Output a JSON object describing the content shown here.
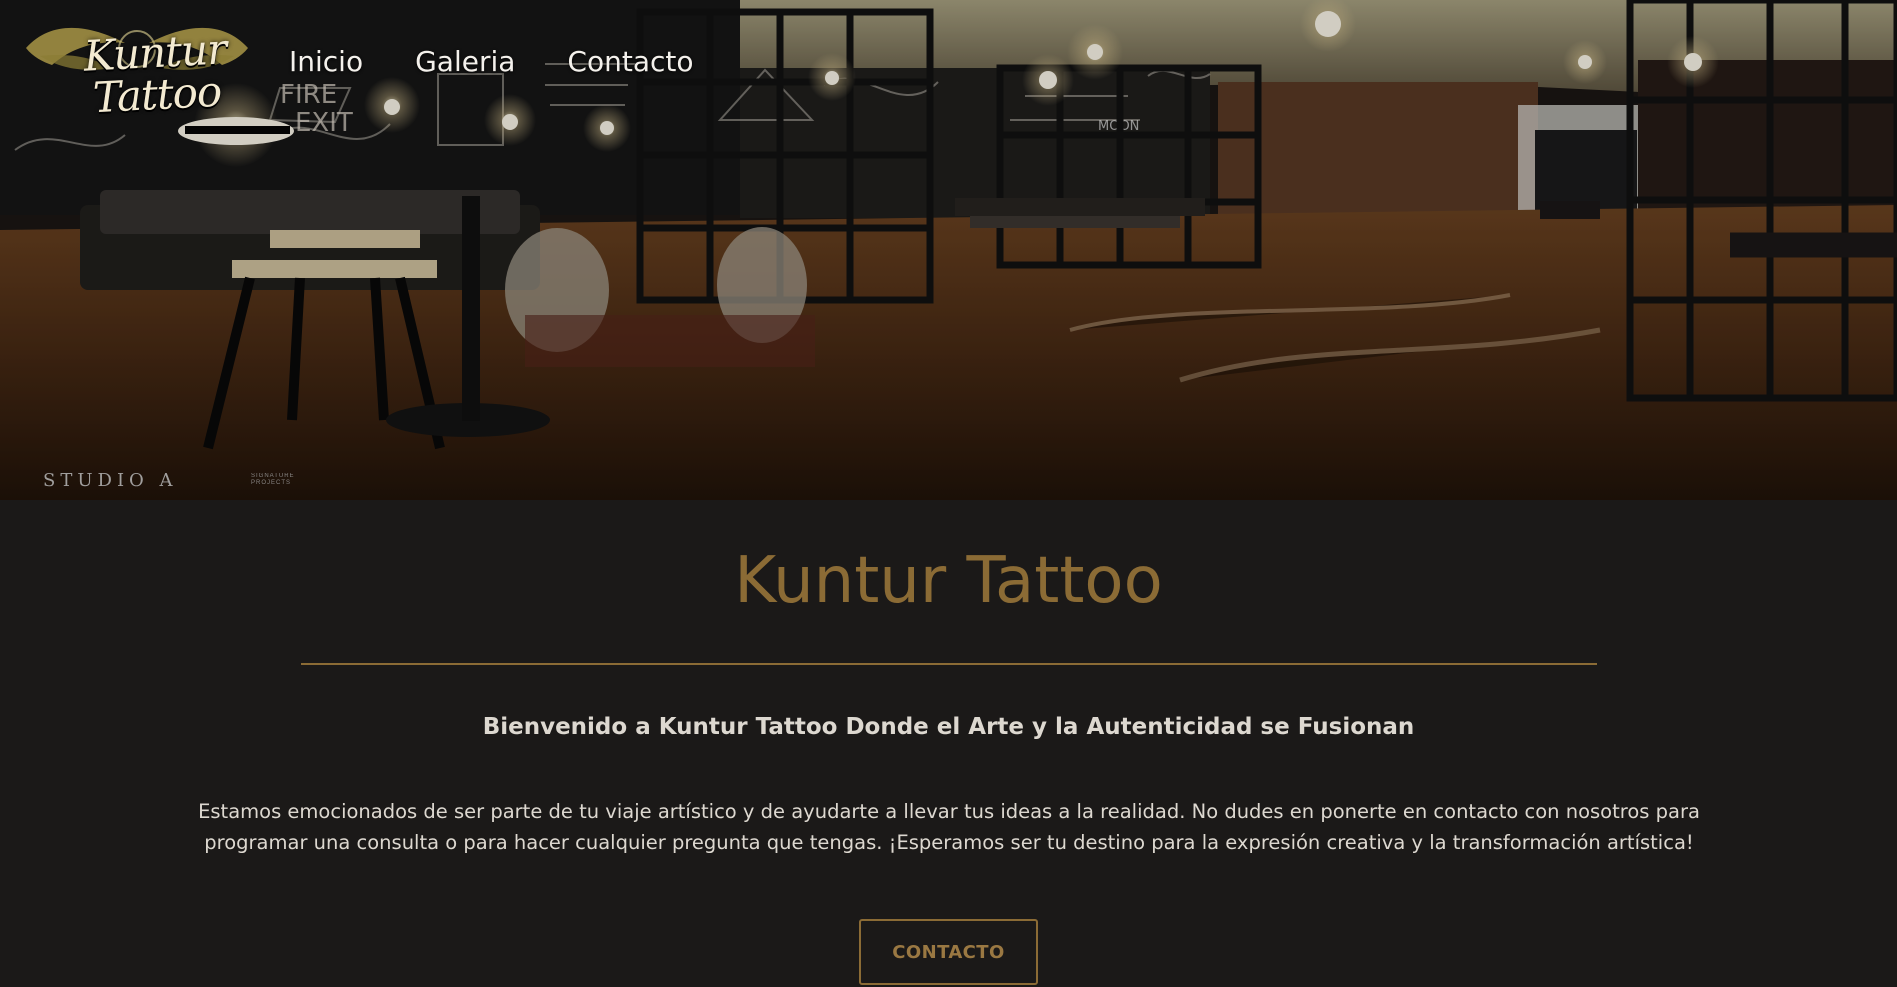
{
  "brand": {
    "logo_text": "Kuntur Tattoo",
    "logo_color": "#b6a14a",
    "accent_color": "#8b6b35"
  },
  "nav": {
    "items": [
      {
        "label": "Inicio"
      },
      {
        "label": "Galeria"
      },
      {
        "label": "Contacto"
      }
    ]
  },
  "hero": {
    "photo_subject": "tattoo studio interior",
    "studio_credit": "STUDIO A",
    "studio_subcredit": "SIGNATURE PROJECTS"
  },
  "main": {
    "title": "Kuntur Tattoo",
    "subtitle": "Bienvenido a Kuntur Tattoo Donde el Arte y la Autenticidad se Fusionan",
    "paragraph": "Estamos emocionados de ser parte de tu viaje artístico y de ayudarte a llevar tus ideas a la realidad. No dudes en ponerte en contacto con nosotros para programar una consulta o para hacer cualquier pregunta que tengas. ¡Esperamos ser tu destino para la expresión creativa y la transformación artística!",
    "button_label": "CONTACTO"
  }
}
